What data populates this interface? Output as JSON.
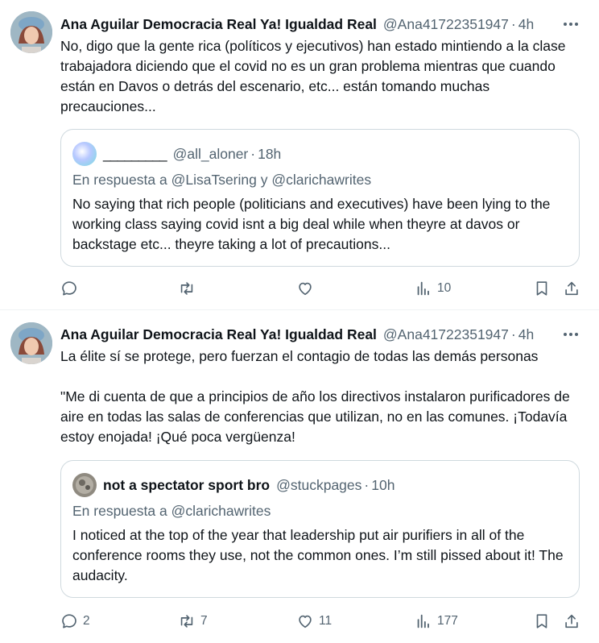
{
  "tweets": [
    {
      "author_name": "Ana Aguilar Democracia Real Ya! Igualdad Real",
      "author_handle": "@Ana41722351947",
      "time": "4h",
      "text": "No, digo que la gente rica (políticos y ejecutivos) han estado mintiendo a la clase trabajadora diciendo que el covid no es un gran problema mientras que cuando están en Davos o detrás del escenario, etc... están tomando muchas precauciones...",
      "quote": {
        "author_name": "_________",
        "author_handle": "@all_aloner",
        "time": "18h",
        "reply_to": "En respuesta a @LisaTsering y @clarichawrites",
        "text": "No saying that rich people (politicians and executives) have been lying to the working class saying covid isnt a big deal while when theyre at davos or backstage etc... theyre taking a lot of precautions..."
      },
      "actions": {
        "replies": "",
        "retweets": "",
        "likes": "",
        "views": "10"
      }
    },
    {
      "author_name": "Ana Aguilar Democracia Real Ya! Igualdad Real",
      "author_handle": "@Ana41722351947",
      "time": "4h",
      "text": "La élite sí se protege, pero fuerzan el contagio de todas las demás personas\n\n\"Me di cuenta de que a principios de año los directivos instalaron purificadores de aire en todas las salas de conferencias que utilizan, no en las comunes. ¡Todavía estoy enojada! ¡Qué poca vergüenza!",
      "quote": {
        "author_name": "not a spectator sport bro",
        "author_handle": "@stuckpages",
        "time": "10h",
        "reply_to": "En respuesta a @clarichawrites",
        "text": "I noticed at the top of the year that leadership put air purifiers in all of the conference rooms they use, not the common ones. I’m still pissed about it! The audacity."
      },
      "actions": {
        "replies": "2",
        "retweets": "7",
        "likes": "11",
        "views": "177"
      }
    }
  ],
  "separator": "·",
  "icons": [
    "more-icon",
    "reply-icon",
    "retweet-icon",
    "like-icon",
    "views-icon",
    "bookmark-icon",
    "share-icon"
  ],
  "colors": {
    "text": "#0f1419",
    "secondary": "#536471",
    "border": "#cfd9de",
    "divider": "#eff3f4"
  }
}
